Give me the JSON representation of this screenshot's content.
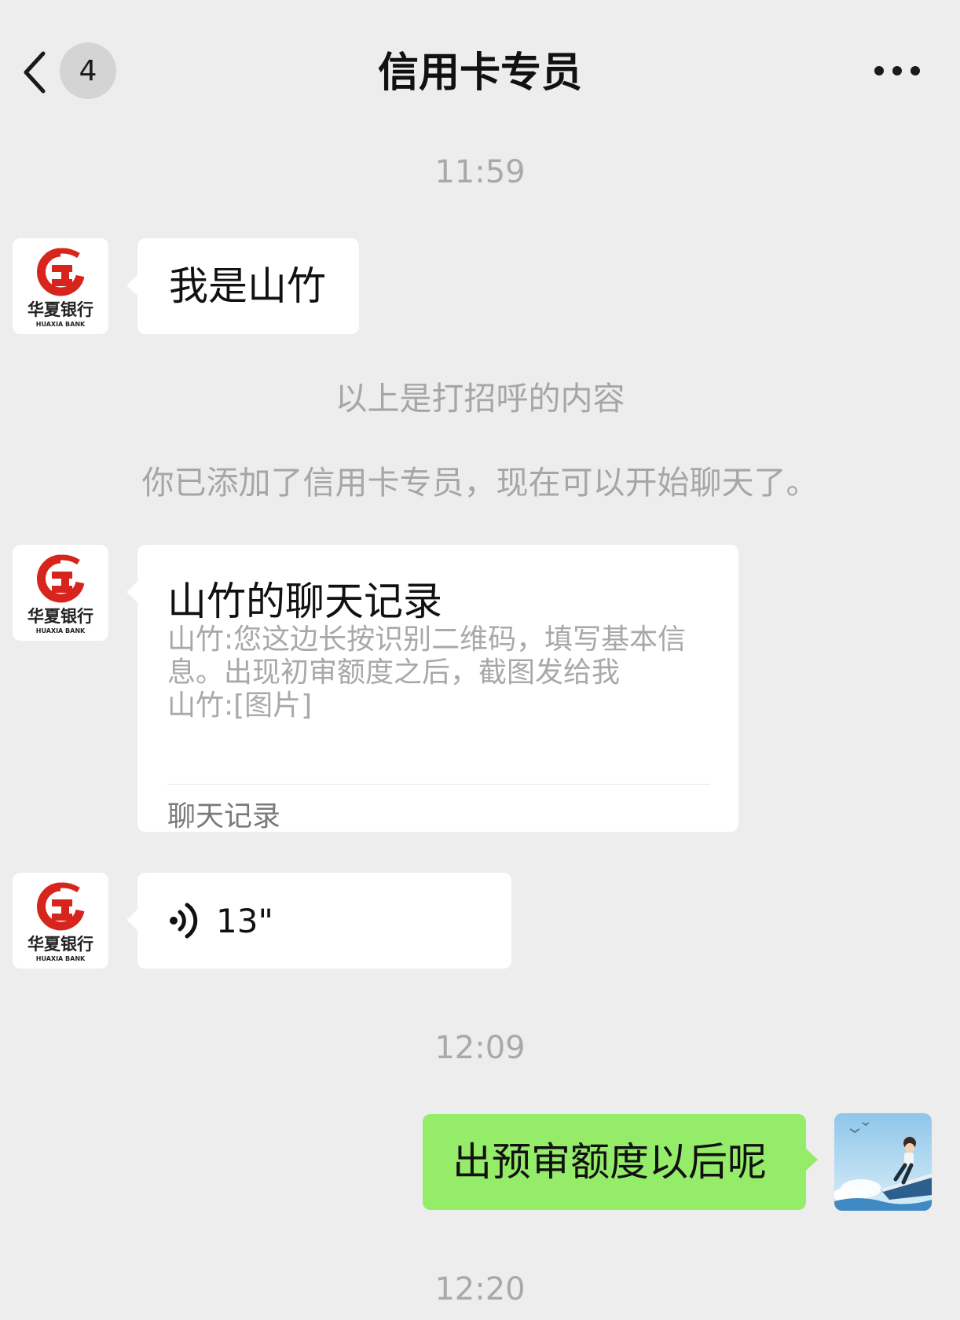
{
  "header": {
    "back_icon": "chevron-left-icon",
    "unread_count": "4",
    "title": "信用卡专员",
    "more_icon": "more-dots-icon"
  },
  "bank_logo": {
    "name_cn": "华夏银行",
    "name_en": "HUAXIA BANK",
    "color": "#d7251d"
  },
  "messages": {
    "ts1": "11:59",
    "greeting": "我是山竹",
    "sys_greeting_note": "以上是打招呼的内容",
    "sys_added_note": "你已添加了信用卡专员，现在可以开始聊天了。",
    "record": {
      "title": "山竹的聊天记录",
      "lines": [
        "山竹:您这边长按识别二维码，填写基本信",
        "息。出现初审额度之后，截图发给我",
        "山竹:[图片]"
      ],
      "footer": "聊天记录"
    },
    "voice": {
      "icon": "voice-wave-icon",
      "duration": "13\""
    },
    "ts2": "12:09",
    "my_reply": "出预审额度以后呢",
    "ts3": "12:20"
  },
  "colors": {
    "background": "#ededed",
    "self_bubble": "#95ec69",
    "other_bubble": "#ffffff"
  }
}
